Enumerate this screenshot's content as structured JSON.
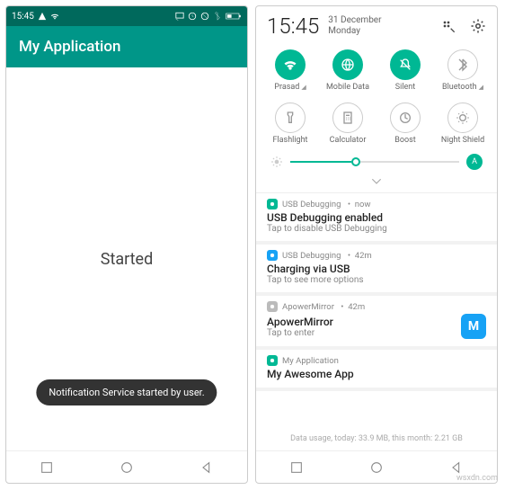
{
  "left": {
    "status_time": "15:45",
    "app_title": "My Application",
    "center_text": "Started",
    "toast_text": "Notification Service started by user."
  },
  "right": {
    "time": "15:45",
    "date_day": "31 December",
    "date_weekday": "Monday",
    "tiles_row1": [
      {
        "label": "Prasad",
        "state": "on",
        "icon": "wifi",
        "tri": true
      },
      {
        "label": "Mobile Data",
        "state": "on",
        "icon": "globe"
      },
      {
        "label": "Silent",
        "state": "on",
        "icon": "bell-off"
      },
      {
        "label": "Bluetooth",
        "state": "off",
        "icon": "bluetooth",
        "tri": true
      }
    ],
    "tiles_row2": [
      {
        "label": "Flashlight",
        "state": "off",
        "icon": "flashlight"
      },
      {
        "label": "Calculator",
        "state": "off",
        "icon": "calculator"
      },
      {
        "label": "Boost",
        "state": "off",
        "icon": "boost"
      },
      {
        "label": "Night Shield",
        "state": "off",
        "icon": "night"
      }
    ],
    "brightness_auto": "A",
    "notifications": [
      {
        "app": "USB Debugging",
        "time": "now",
        "title": "USB Debugging enabled",
        "sub": "Tap to disable USB Debugging",
        "badge": "green",
        "icon": "bug"
      },
      {
        "app": "USB Debugging",
        "time": "42m",
        "title": "Charging via USB",
        "sub": "Tap to see more options",
        "badge": "blue",
        "icon": "usb"
      },
      {
        "app": "ApowerMirror",
        "time": "42m",
        "title": "ApowerMirror",
        "sub": "Tap to enter",
        "badge": "gray",
        "icon": "",
        "apm": true
      },
      {
        "app": "My Application",
        "time": "",
        "title": "My Awesome App",
        "sub": "",
        "badge": "green",
        "icon": "app"
      }
    ],
    "data_usage": "Data usage, today: 33.9 MB, this month: 2.21 GB"
  },
  "watermark": "wsxdn.com"
}
